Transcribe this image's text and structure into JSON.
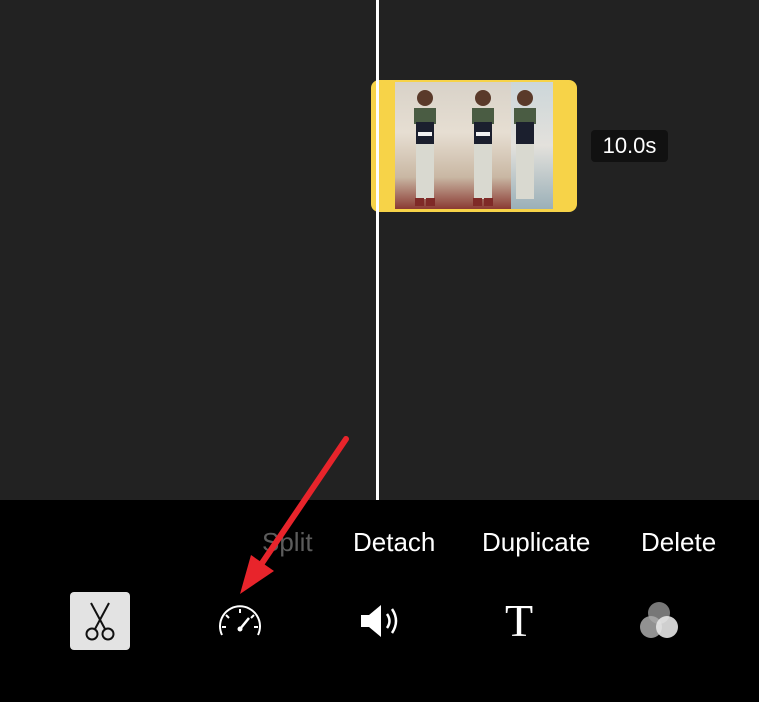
{
  "clip": {
    "duration_label": "10.0s",
    "color": "#f7d348"
  },
  "actions": {
    "split_label": "Split",
    "detach_label": "Detach",
    "duplicate_label": "Duplicate",
    "delete_label": "Delete"
  },
  "tools": [
    {
      "icon": "scissors-icon",
      "selected": true
    },
    {
      "icon": "speedometer-icon",
      "selected": false
    },
    {
      "icon": "speaker-icon",
      "selected": false
    },
    {
      "icon": "title-t-icon",
      "glyph": "T",
      "selected": false
    },
    {
      "icon": "filters-icon",
      "selected": false
    }
  ],
  "annotation": {
    "icon": "red-arrow-icon",
    "color": "#e8242b"
  }
}
